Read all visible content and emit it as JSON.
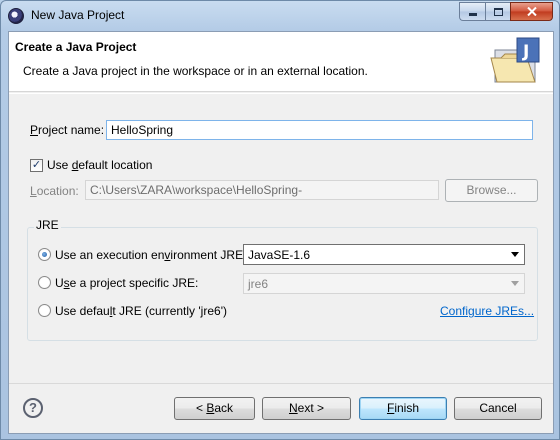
{
  "window": {
    "title": "New Java Project"
  },
  "header": {
    "title": "Create a Java Project",
    "description": "Create a Java project in the workspace or in an external location."
  },
  "project_name": {
    "label_mn": "P",
    "label_rest": "roject name:",
    "value": "HelloSpring"
  },
  "default_location": {
    "label_pre": "Use ",
    "label_mn": "d",
    "label_rest": "efault location",
    "checked": true
  },
  "location": {
    "label_mn": "L",
    "label_rest": "ocation:",
    "value": "C:\\Users\\ZARA\\workspace\\HelloSpring-",
    "browse_label": "Browse..."
  },
  "jre": {
    "legend": "JRE",
    "option_env": {
      "label_pre": "Use an execution en",
      "label_mn": "v",
      "label_rest": "ironment JRE:",
      "selected": true,
      "value": "JavaSE-1.6"
    },
    "option_project": {
      "label_pre": "U",
      "label_mn": "s",
      "label_rest": "e a project specific JRE:",
      "selected": false,
      "value": "jre6"
    },
    "option_default": {
      "label_pre": "Use defau",
      "label_mn": "l",
      "label_rest": "t JRE (currently 'jre6')",
      "selected": false
    },
    "configure_link": "Configure JREs..."
  },
  "buttons": {
    "back": {
      "prefix": "< ",
      "mn": "B",
      "rest": "ack"
    },
    "next": {
      "prefix": "",
      "mn": "N",
      "rest": "ext >"
    },
    "finish": {
      "prefix": "",
      "mn": "F",
      "rest": "inish"
    },
    "cancel": "Cancel"
  },
  "colors": {
    "link": "#0066cc",
    "accent_blue": "#3c7fb1",
    "header_bg": "#ffffff",
    "dialog_bg": "#f0f0f0"
  },
  "icons": [
    "eclipse-app-icon",
    "minimize-icon",
    "maximize-icon",
    "close-icon",
    "java-project-folder-icon",
    "help-icon",
    "dropdown-arrow-icon"
  ]
}
